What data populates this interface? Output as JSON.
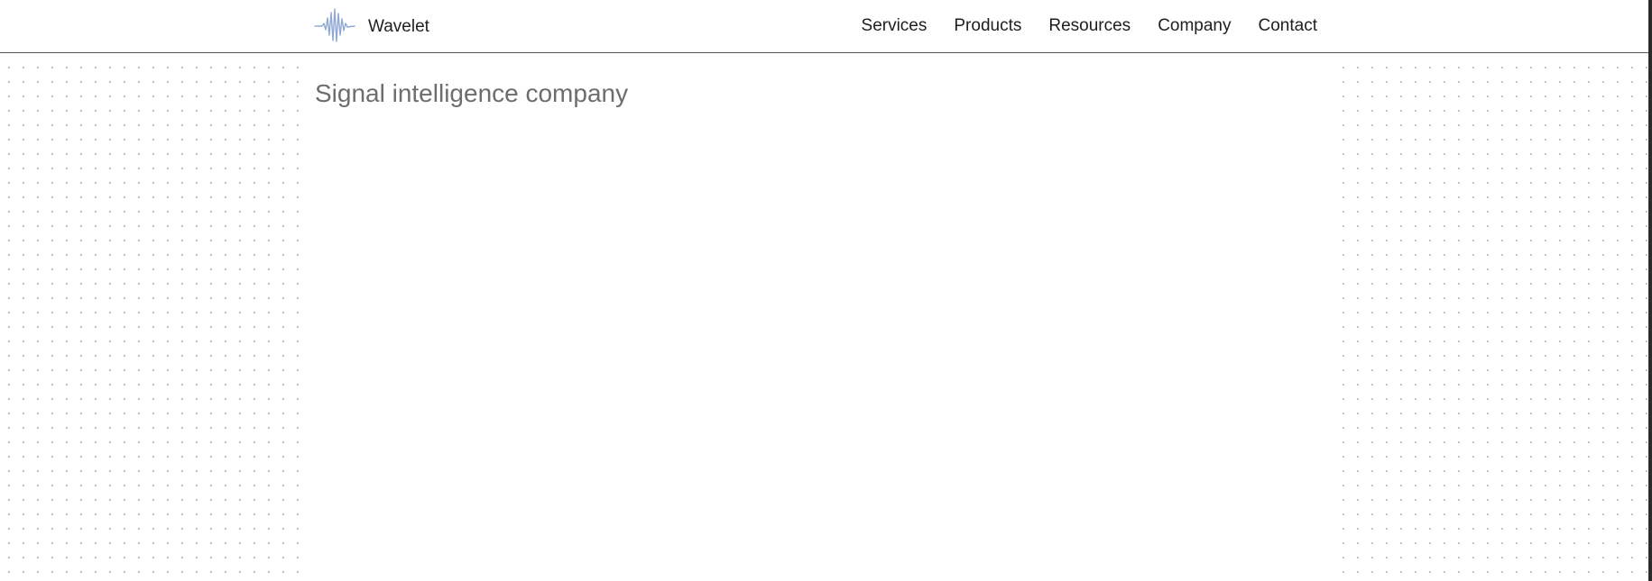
{
  "header": {
    "brand_name": "Wavelet",
    "logo_icon": "waveform-icon",
    "nav": [
      {
        "label": "Services"
      },
      {
        "label": "Products"
      },
      {
        "label": "Resources"
      },
      {
        "label": "Company"
      },
      {
        "label": "Contact"
      }
    ]
  },
  "main": {
    "title": "Signal intelligence company"
  },
  "colors": {
    "logo_stroke": "#8fa8d4",
    "title_text": "#6d6d6d",
    "nav_text": "#1e1e1e",
    "dot_pattern": "#b8b8b8"
  }
}
